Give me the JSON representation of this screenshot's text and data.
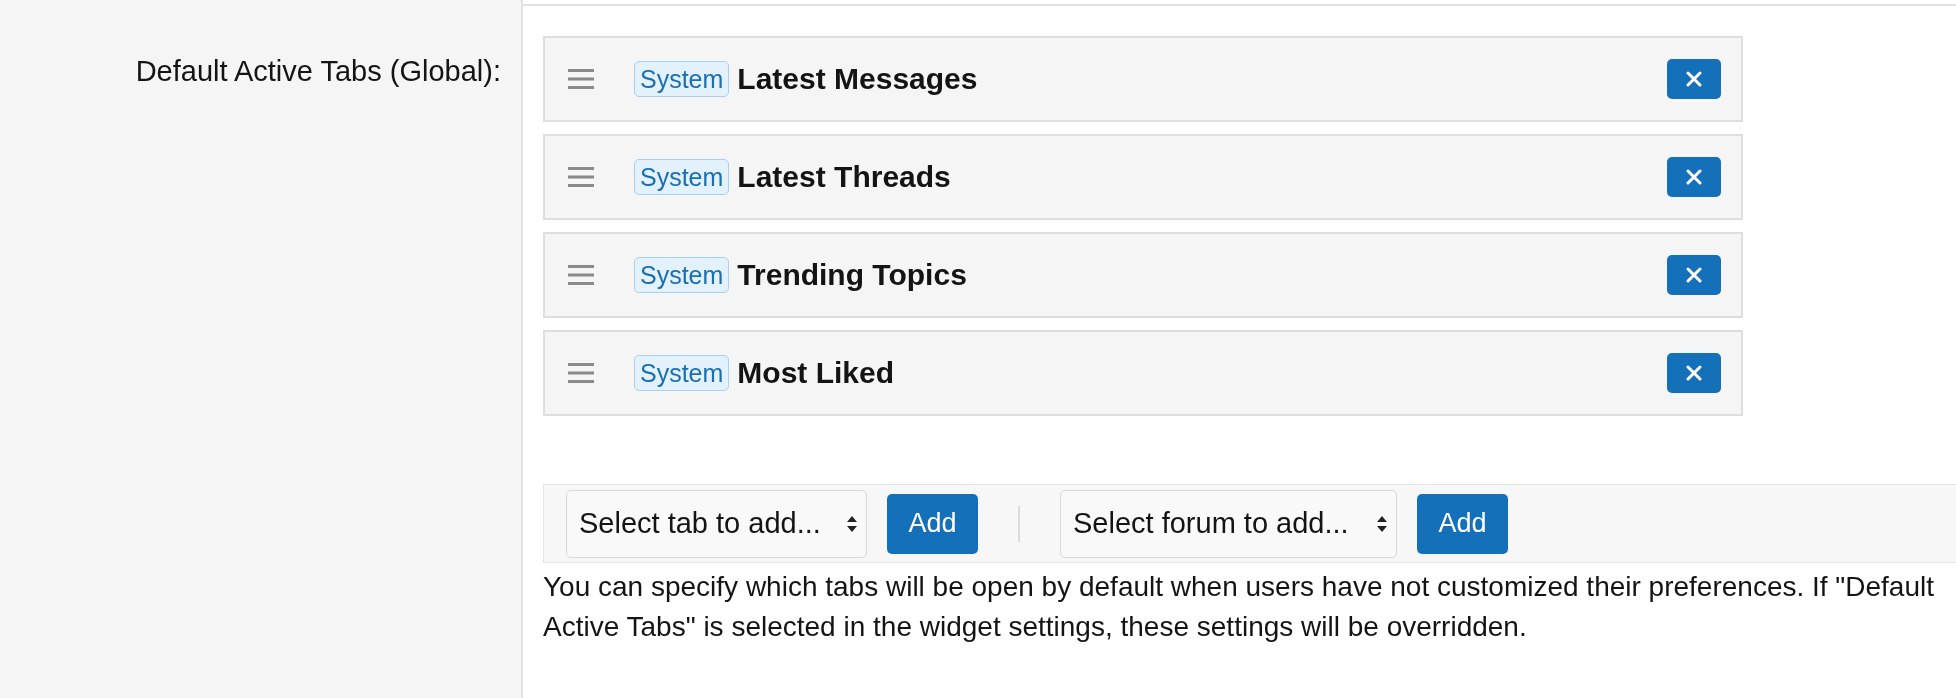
{
  "field": {
    "label": "Default Active Tabs (Global):"
  },
  "active_tabs": [
    {
      "badge": "System",
      "title": "Latest Messages"
    },
    {
      "badge": "System",
      "title": "Latest Threads"
    },
    {
      "badge": "System",
      "title": "Trending Topics"
    },
    {
      "badge": "System",
      "title": "Most Liked"
    }
  ],
  "add_bar": {
    "tab_select": {
      "value": "Select tab to add..."
    },
    "tab_add_button": "Add",
    "forum_select": {
      "value": "Select forum to add..."
    },
    "forum_add_button": "Add"
  },
  "help_text": "You can specify which tabs will be open by default when users have not customized their preferences. If \"Default Active Tabs\" is selected in the widget settings, these settings will be overridden."
}
